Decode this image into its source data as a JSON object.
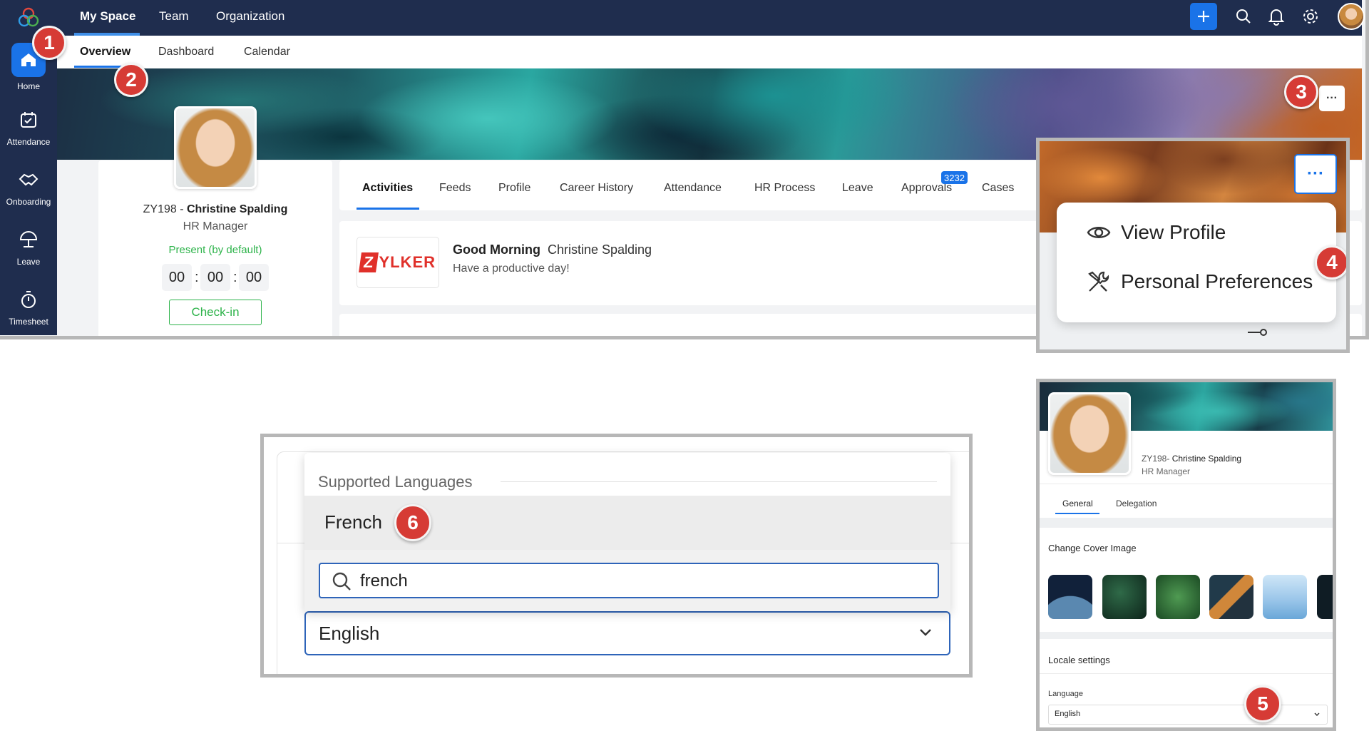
{
  "top_nav": {
    "tabs": [
      {
        "label": "My Space"
      },
      {
        "label": "Team"
      },
      {
        "label": "Organization"
      }
    ]
  },
  "sidebar": {
    "items": [
      {
        "label": "Home",
        "icon": "home-icon"
      },
      {
        "label": "Attendance",
        "icon": "calendar-check-icon"
      },
      {
        "label": "Onboarding",
        "icon": "handshake-icon"
      },
      {
        "label": "Leave",
        "icon": "umbrella-icon"
      },
      {
        "label": "Timesheet",
        "icon": "stopwatch-icon"
      }
    ]
  },
  "sub_nav": {
    "tabs": [
      {
        "label": "Overview"
      },
      {
        "label": "Dashboard"
      },
      {
        "label": "Calendar"
      }
    ]
  },
  "profile": {
    "employee_id": "ZY198 - ",
    "name": "Christine Spalding",
    "role": "HR Manager",
    "status": "Present (by default)",
    "timer": {
      "hours": "00",
      "minutes": "00",
      "seconds": "00",
      "separator": ":"
    },
    "checkin_label": "Check-in"
  },
  "content_tabs": {
    "tabs": [
      {
        "label": "Activities"
      },
      {
        "label": "Feeds"
      },
      {
        "label": "Profile"
      },
      {
        "label": "Career History"
      },
      {
        "label": "Attendance"
      },
      {
        "label": "HR Process"
      },
      {
        "label": "Leave"
      },
      {
        "label": "Approvals"
      },
      {
        "label": "Cases"
      }
    ],
    "approvals_badge": "3232"
  },
  "greeting": {
    "logo_text": "ZYLKER",
    "logo_letter": "Z",
    "logo_rest": "YLKER",
    "title": "Good Morning",
    "name": "Christine Spalding",
    "message": "Have a productive day!"
  },
  "more_menu": {
    "trigger": "···",
    "items": [
      {
        "label": "View Profile",
        "icon": "eye-icon"
      },
      {
        "label": "Personal Preferences",
        "icon": "tools-icon"
      }
    ]
  },
  "language_picker": {
    "section_label": "Supported Languages",
    "option": "French",
    "search_value": "french",
    "selected": "English"
  },
  "preferences_panel": {
    "employee_id": "ZY198- ",
    "name": "Christine Spalding",
    "role": "HR Manager",
    "tabs": [
      {
        "label": "General"
      },
      {
        "label": "Delegation"
      }
    ],
    "cover_section": "Change Cover Image",
    "locale_section": "Locale settings",
    "language_label": "Language",
    "language_value": "English"
  },
  "step_badges": [
    "1",
    "2",
    "3",
    "4",
    "5",
    "6"
  ],
  "colors": {
    "nav_bg": "#1f2d4e",
    "accent_blue": "#1a73e8",
    "present_green": "#2db34a",
    "badge_red": "#d63b35"
  }
}
